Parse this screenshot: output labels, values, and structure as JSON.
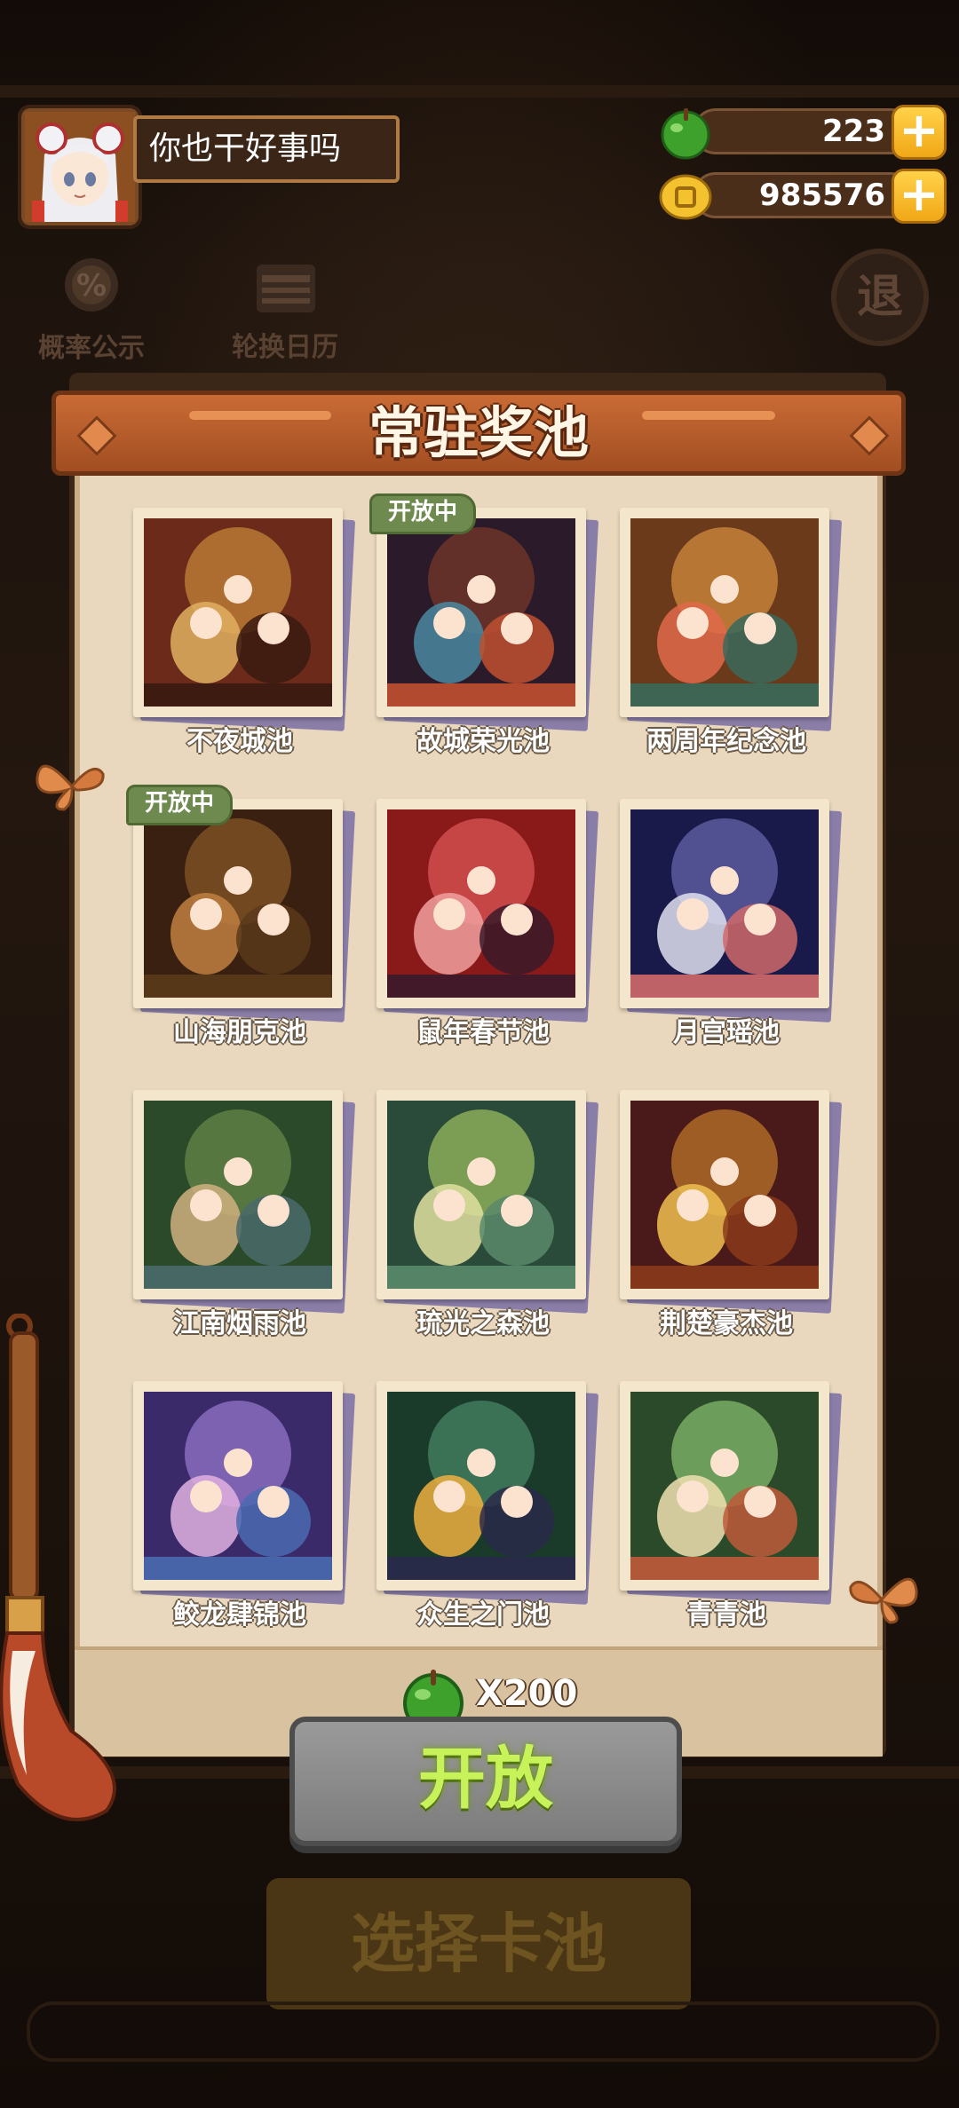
{
  "player": {
    "name": "你也干好事吗"
  },
  "currency": {
    "apple": "223",
    "coin": "985576",
    "plus_label": "+"
  },
  "side_buttons": {
    "probability": "概率公示",
    "rotation": "轮换日历",
    "exit": "退"
  },
  "dialog": {
    "title": "常驻奖池",
    "open_tag": "开放中",
    "pools": [
      {
        "name": "不夜城池",
        "open": false
      },
      {
        "name": "故城荣光池",
        "open": true
      },
      {
        "name": "两周年纪念池",
        "open": false
      },
      {
        "name": "山海朋克池",
        "open": true
      },
      {
        "name": "鼠年春节池",
        "open": false
      },
      {
        "name": "月宫瑶池",
        "open": false
      },
      {
        "name": "江南烟雨池",
        "open": false
      },
      {
        "name": "琉光之森池",
        "open": false
      },
      {
        "name": "荆楚豪杰池",
        "open": false
      },
      {
        "name": "鲛龙肆锦池",
        "open": false
      },
      {
        "name": "众生之门池",
        "open": false
      },
      {
        "name": "青青池",
        "open": false
      }
    ],
    "cost": "X200",
    "open_button": "开放"
  },
  "background": {
    "select_pool_button": "选择卡池"
  },
  "colors": {
    "accent_banner": "#b85a2a",
    "open_tag": "#6f8a4e",
    "open_button_text": "#c8f25a",
    "currency_plus": "#f5b82a"
  }
}
